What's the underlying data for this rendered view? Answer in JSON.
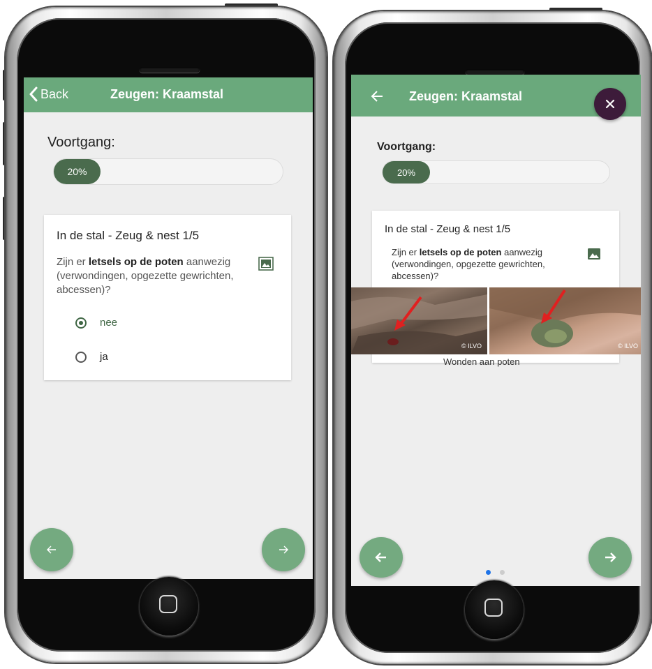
{
  "left_screen": {
    "back_label": "Back",
    "title": "Zeugen: Kraamstal",
    "progress_label": "Voortgang:",
    "progress_text": "20%",
    "progress_value": 0.2,
    "card_title": "In de stal - Zeug & nest 1/5",
    "question_prefix": "Zijn er ",
    "question_bold": "letsels op de poten",
    "question_suffix": " aanwezig (verwondingen, opgezette gewrichten, abcessen)?",
    "options": [
      {
        "label": "nee",
        "checked": true
      },
      {
        "label": "ja",
        "checked": false
      }
    ],
    "prev_icon": "arrow-left-icon",
    "next_icon": "arrow-right-icon"
  },
  "right_screen": {
    "title": "Zeugen: Kraamstal",
    "progress_label": "Voortgang:",
    "progress_text": "20%",
    "progress_value": 0.2,
    "card_title": "In de stal - Zeug & nest 1/5",
    "question_prefix": "Zijn er ",
    "question_bold": "letsels op de poten",
    "question_suffix": " aanwezig (verwondingen, opgezette gewrichten, abcessen)?",
    "photo_watermark_1": "© ILVO",
    "photo_watermark_2": "© ILVO",
    "caption": "Wonden aan poten",
    "close_icon": "close-icon",
    "active_dot_color": "#1e73e8",
    "inactive_dot_color": "#cccccc"
  },
  "colors": {
    "appbar": "#6aa97c",
    "progress_fill": "#4a6b4d",
    "fab": "#74aa80",
    "close_fab": "#3d1b3a"
  }
}
